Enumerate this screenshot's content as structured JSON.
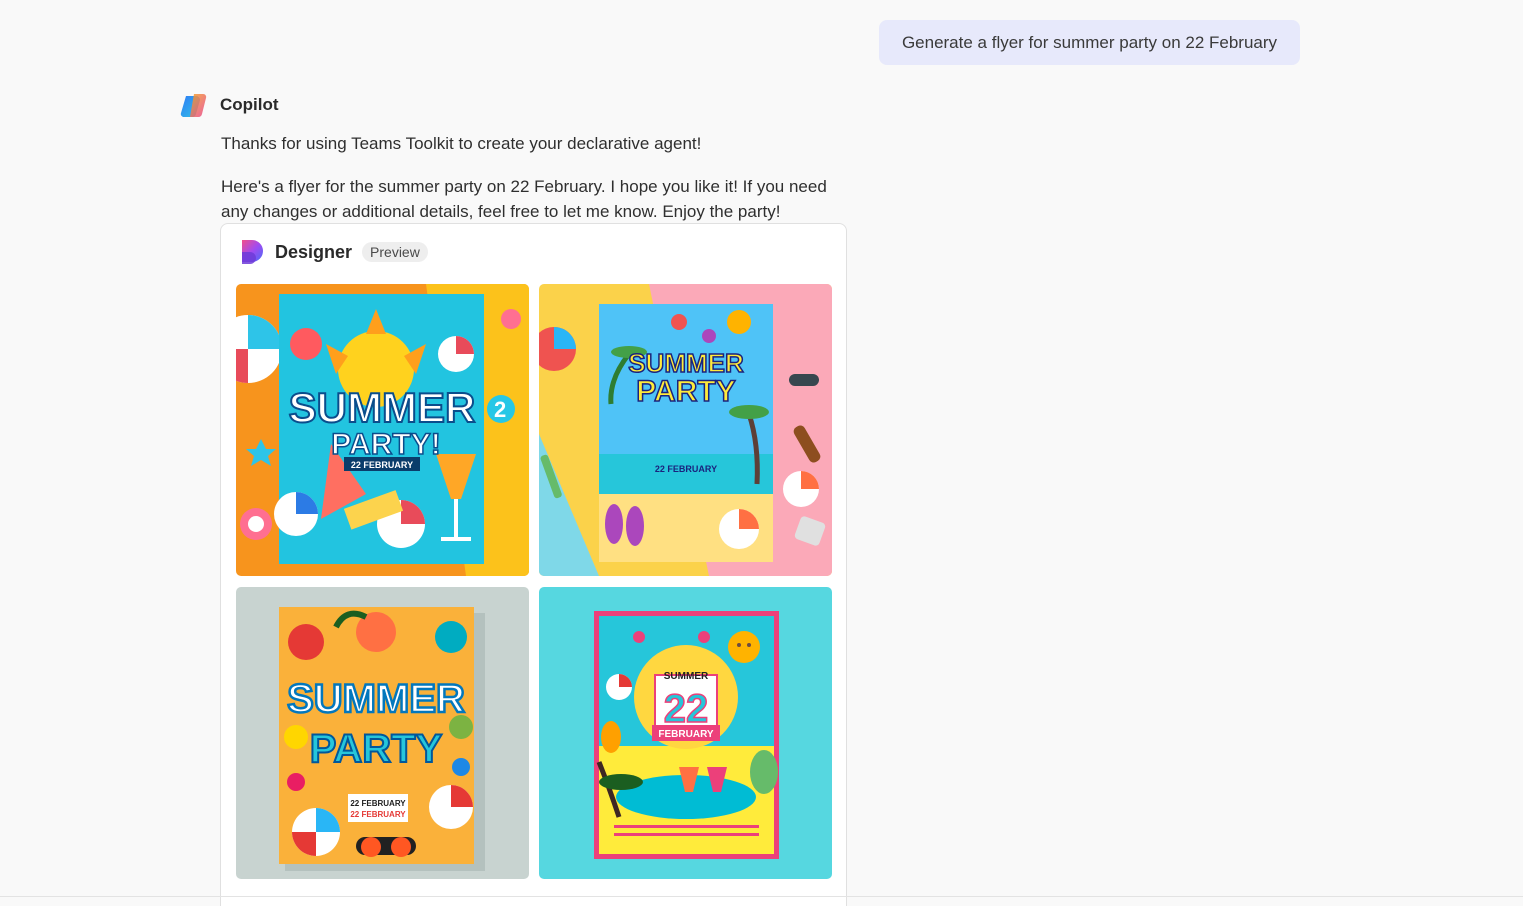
{
  "user_message": "Generate a flyer for summer party on 22 February",
  "assistant": {
    "name": "Copilot",
    "messages": [
      "Thanks for using Teams Toolkit to create your declarative agent!",
      "Here's a flyer for the summer party on 22 February. I hope you like it! If you need any changes or additional details, feel free to let me know. Enjoy the party!"
    ]
  },
  "designer": {
    "title": "Designer",
    "badge": "Preview",
    "images": [
      {
        "headline": "SUMMER",
        "subhead": "PARTY!",
        "date": "22 FEBRUARY"
      },
      {
        "headline": "SUMMER",
        "subhead": "PARTY",
        "date": "22 FEBRUARY"
      },
      {
        "headline": "SUMMER",
        "subhead": "PARTY",
        "date": "22 FEBRUARY"
      },
      {
        "headline": "SUMMER",
        "day": "22",
        "month": "FEBRUARY"
      }
    ]
  },
  "colors": {
    "user_bubble": "#e7e9fb",
    "background": "#f9f9f9"
  }
}
